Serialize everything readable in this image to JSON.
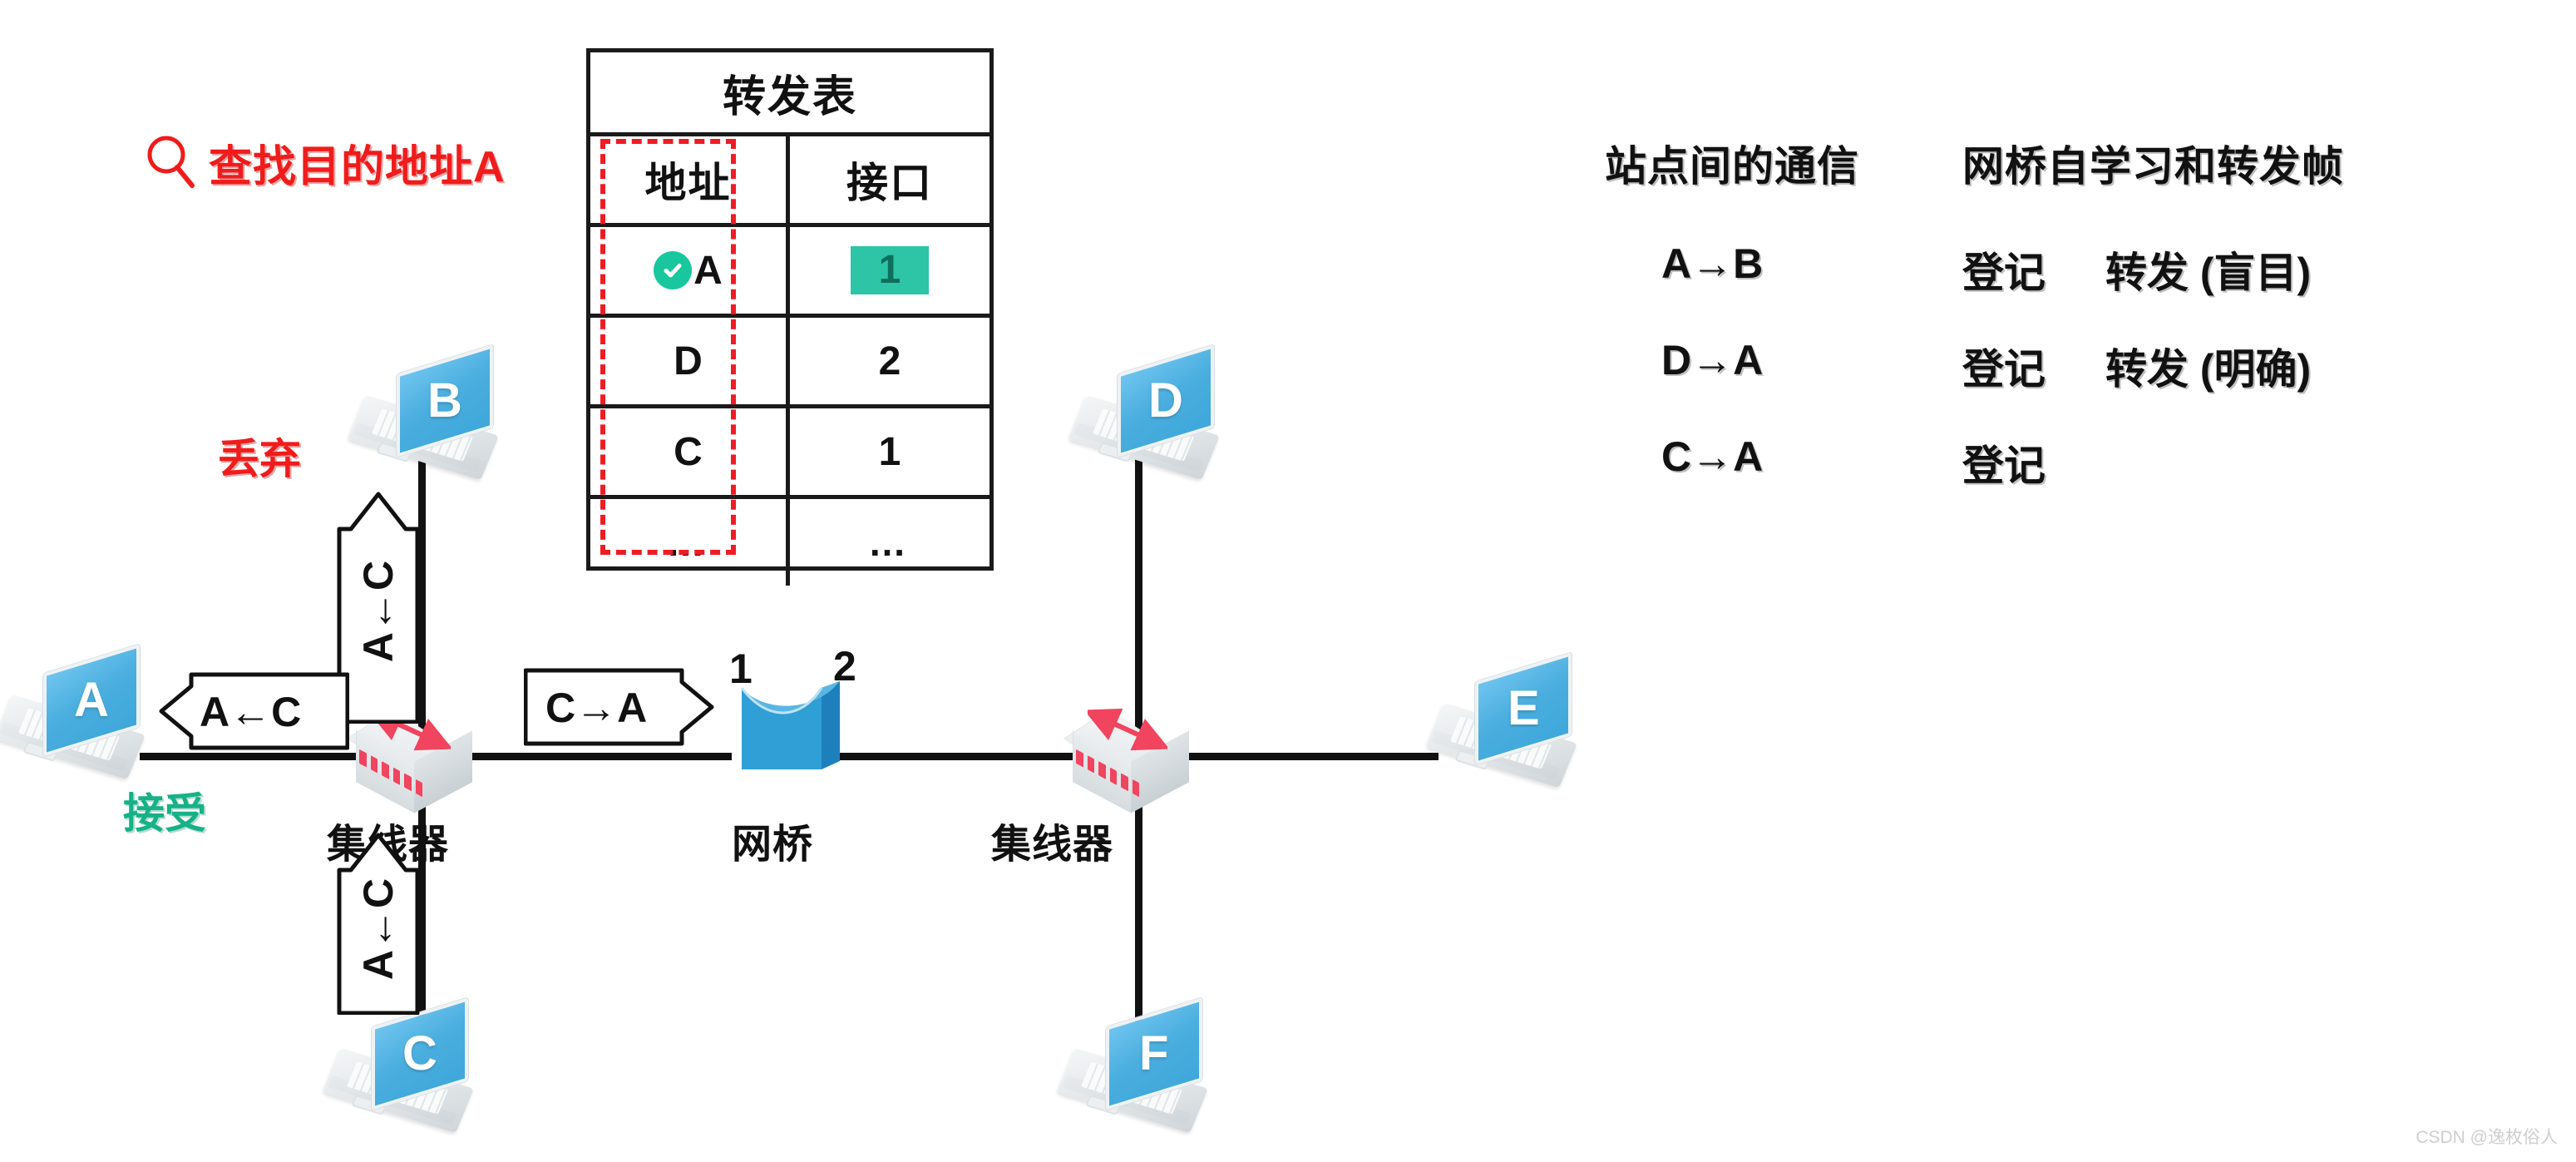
{
  "search_callout": {
    "icon": "magnifier-icon",
    "text": "查找目的地址A",
    "color": "#f01c1c"
  },
  "forwarding_table": {
    "title": "转发表",
    "headers": [
      "地址",
      "接口"
    ],
    "rows": [
      {
        "address": "A",
        "interface": "1",
        "checked": true,
        "highlight": true
      },
      {
        "address": "D",
        "interface": "2",
        "checked": false,
        "highlight": false
      },
      {
        "address": "C",
        "interface": "1",
        "checked": false,
        "highlight": false
      },
      {
        "address": "…",
        "interface": "…",
        "checked": false,
        "highlight": false
      }
    ],
    "highlight_color": "#2ec4a6",
    "check_color": "#18c79e",
    "dashed_outline_color": "#ee1c25"
  },
  "panel": {
    "col1_title": "站点间的通信",
    "col2_title": "网桥自学习和转发帧",
    "rows": [
      {
        "flow": "A→B",
        "action": "登记",
        "result": "转发 (盲目)"
      },
      {
        "flow": "D→A",
        "action": "登记",
        "result": "转发 (明确)"
      },
      {
        "flow": "C→A",
        "action": "登记",
        "result": ""
      }
    ]
  },
  "topology": {
    "hosts": [
      {
        "id": "laptop-a",
        "letter": "A"
      },
      {
        "id": "laptop-b",
        "letter": "B"
      },
      {
        "id": "laptop-c",
        "letter": "C"
      },
      {
        "id": "laptop-d",
        "letter": "D"
      },
      {
        "id": "laptop-e",
        "letter": "E"
      },
      {
        "id": "laptop-f",
        "letter": "F"
      }
    ],
    "devices": [
      {
        "id": "hub-left",
        "label": "集线器"
      },
      {
        "id": "bridge",
        "label": "网桥"
      },
      {
        "id": "hub-right",
        "label": "集线器"
      }
    ],
    "bridge_ports": [
      "1",
      "2"
    ],
    "frames": [
      {
        "id": "frame-to-b",
        "text": "A←C",
        "orientation": "vertical-up"
      },
      {
        "id": "frame-to-a",
        "text": "A←C",
        "orientation": "horizontal-left"
      },
      {
        "id": "frame-from-c",
        "text": "A←C",
        "orientation": "vertical-up"
      },
      {
        "id": "frame-c-to-a",
        "text": "C→A",
        "orientation": "horizontal-right"
      }
    ],
    "annotations": [
      {
        "id": "discard-label",
        "text": "丢弃",
        "color": "#f01c1c"
      },
      {
        "id": "accept-label",
        "text": "接受",
        "color": "#16b187"
      }
    ]
  },
  "watermark": "CSDN @逸枚俗人"
}
